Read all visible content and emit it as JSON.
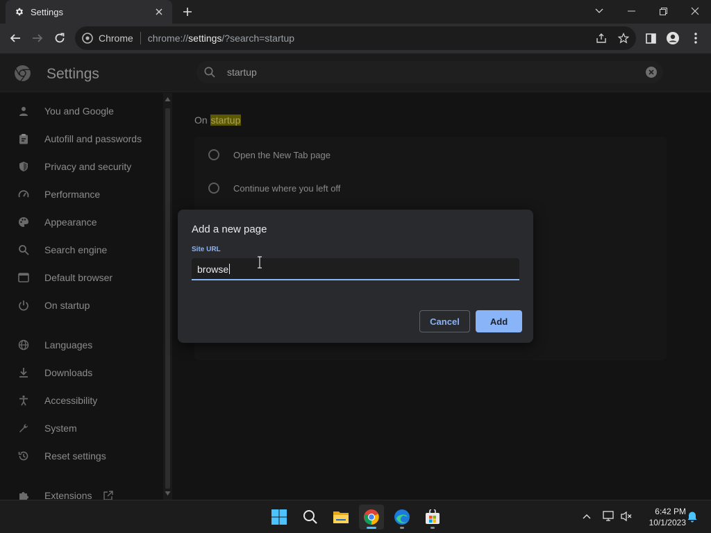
{
  "browser": {
    "tab_title": "Settings",
    "omnibox_chip": "Chrome",
    "url_prefix": "chrome://",
    "url_host": "settings",
    "url_suffix": "/?search=startup"
  },
  "settings": {
    "title": "Settings",
    "search_value": "startup",
    "sidebar": [
      {
        "label": "You and Google",
        "icon": "person-icon"
      },
      {
        "label": "Autofill and passwords",
        "icon": "clipboard-icon"
      },
      {
        "label": "Privacy and security",
        "icon": "shield-icon"
      },
      {
        "label": "Performance",
        "icon": "speedometer-icon"
      },
      {
        "label": "Appearance",
        "icon": "palette-icon"
      },
      {
        "label": "Search engine",
        "icon": "search-icon"
      },
      {
        "label": "Default browser",
        "icon": "browser-icon"
      },
      {
        "label": "On startup",
        "icon": "power-icon"
      },
      {
        "label": "Languages",
        "icon": "globe-icon"
      },
      {
        "label": "Downloads",
        "icon": "download-icon"
      },
      {
        "label": "Accessibility",
        "icon": "accessibility-icon"
      },
      {
        "label": "System",
        "icon": "wrench-icon"
      },
      {
        "label": "Reset settings",
        "icon": "history-icon"
      },
      {
        "label": "Extensions",
        "icon": "puzzle-icon"
      }
    ],
    "section_heading_prefix": "On",
    "section_heading_highlight": "startup",
    "options": [
      {
        "label": "Open the New Tab page",
        "selected": false
      },
      {
        "label": "Continue where you left off",
        "selected": false
      }
    ]
  },
  "dialog": {
    "title": "Add a new page",
    "field_label": "Site URL",
    "field_value": "browse",
    "cancel_label": "Cancel",
    "add_label": "Add"
  },
  "taskbar": {
    "apps": [
      "start-icon",
      "search-icon",
      "file-explorer-icon",
      "chrome-icon",
      "edge-icon",
      "store-icon"
    ],
    "time": "6:42 PM",
    "date": "10/1/2023"
  },
  "colors": {
    "accent": "#8ab4f8",
    "highlight": "#5c5800",
    "windows_accent": "#4cc2ff"
  }
}
